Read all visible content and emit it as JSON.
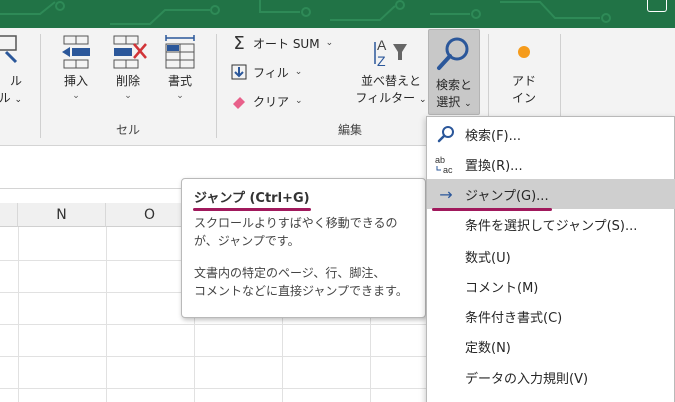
{
  "ribbon": {
    "cells_partial": {
      "line1": "ル",
      "line2": "ル"
    },
    "insert": "挿入",
    "delete": "削除",
    "format": "書式",
    "cells_group": "セル",
    "autosum": "オート SUM",
    "fill": "フィル",
    "clear": "クリア",
    "sort_filter_line1": "並べ替えと",
    "sort_filter_line2": "フィルター",
    "find_select_line1": "検索と",
    "find_select_line2": "選択",
    "addin_line1": "アド",
    "addin_line2": "イン",
    "editing_group": "編集"
  },
  "sheet": {
    "columns": [
      "",
      "N",
      "O",
      ""
    ]
  },
  "tooltip": {
    "title": "ジャンプ (Ctrl+G)",
    "line1": "スクロールよりすばやく移動できるの",
    "line2": "が、ジャンプです。",
    "line3": "文書内の特定のページ、行、脚注、",
    "line4": "コメントなどに直接ジャンプできます。"
  },
  "menu": {
    "items": [
      {
        "label": "検索(F)...",
        "icon": "search-icon"
      },
      {
        "label": "置換(R)...",
        "icon": "replace-icon"
      },
      {
        "label": "ジャンプ(G)...",
        "icon": "arrow-right-icon"
      },
      {
        "label": "条件を選択してジャンプ(S)...",
        "icon": ""
      },
      {
        "label": "数式(U)",
        "icon": ""
      },
      {
        "label": "コメント(M)",
        "icon": ""
      },
      {
        "label": "条件付き書式(C)",
        "icon": ""
      },
      {
        "label": "定数(N)",
        "icon": ""
      },
      {
        "label": "データの入力規則(V)",
        "icon": ""
      }
    ]
  },
  "colors": {
    "title_bar": "#217346",
    "accent_blue": "#2b579a",
    "annotation": "#a0195c",
    "addin_dot": "#f59b1b"
  }
}
